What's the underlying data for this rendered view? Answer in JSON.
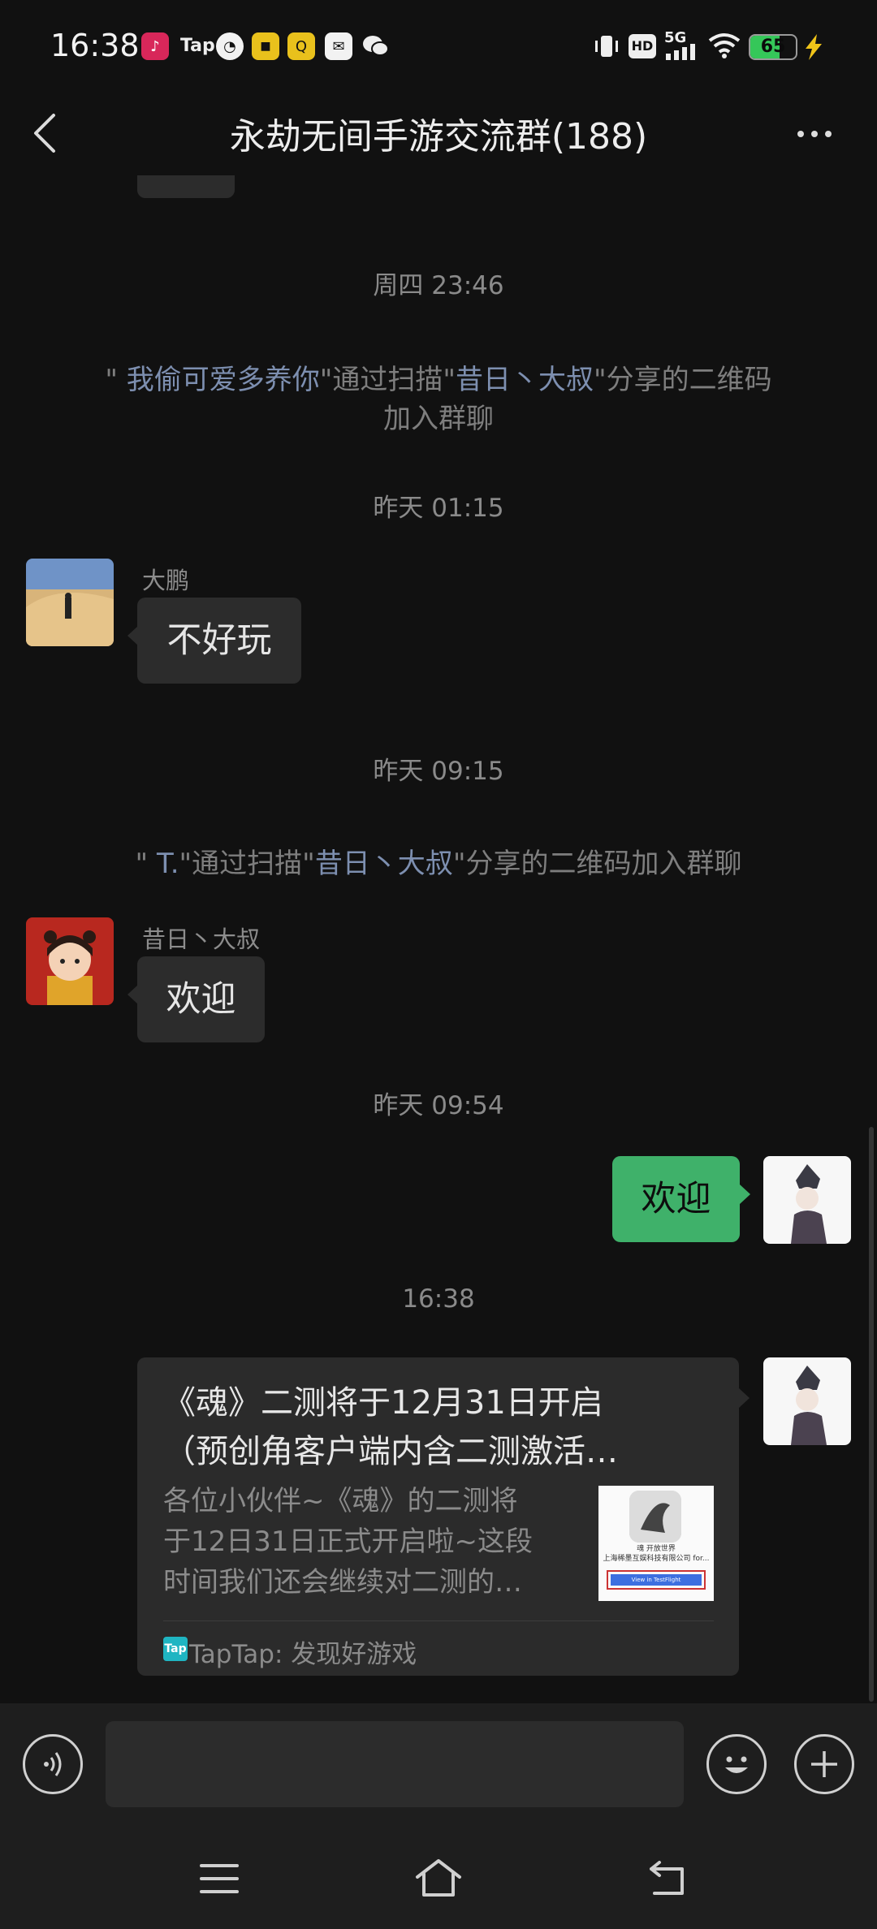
{
  "status_bar": {
    "time": "16:38",
    "apps": [
      "tiktok-icon",
      "taptap-icon",
      "speed-icon",
      "manga-icon",
      "q-icon",
      "mail-icon",
      "wechat-icon"
    ],
    "tap_label": "Tap",
    "network": "5G",
    "hd_label": "HD",
    "battery": "65",
    "battery_level": 0.65
  },
  "header": {
    "title": "永劫无间手游交流群(188)"
  },
  "chat": {
    "time1": "周四 23:46",
    "system1": {
      "q_open": "\" ",
      "user": "我偷可爱多养你",
      "text1": "\"通过扫描\"",
      "inviter": "昔日丶大叔",
      "text2": "\"分享的二维码",
      "line2": "加入群聊"
    },
    "time2": "昨天 01:15",
    "msg1": {
      "sender": "大鹏",
      "text": "不好玩"
    },
    "time3": "昨天 09:15",
    "system2": {
      "q_open": "\" ",
      "user": "T.",
      "text1": "\"通过扫描\"",
      "inviter": "昔日丶大叔",
      "text2": "\"分享的二维码加入群聊"
    },
    "msg2": {
      "sender": "昔日丶大叔",
      "text": "欢迎"
    },
    "time4": "昨天 09:54",
    "msg3": {
      "text": "欢迎"
    },
    "time5": "16:38",
    "card": {
      "title_line1": "《魂》二测将于12月31日开启",
      "title_line2": "（预创角客户端内含二测激活…",
      "desc_line1": "各位小伙伴~《魂》的二测将",
      "desc_line2": "于12日31日正式开启啦~这段",
      "desc_line3": "时间我们还会继续对二测的…",
      "thumb_line1": "魂 开放世界",
      "thumb_line2": "上海稀墨互娱科技有限公司 for...",
      "thumb_button": "View in TestFlight",
      "source_icon": "Tap",
      "source": "TapTap: 发现好游戏"
    }
  },
  "input": {
    "placeholder": ""
  },
  "colors": {
    "background": "#111111",
    "bubble_left": "#2c2c2c",
    "bubble_right": "#3fb16a",
    "link": "#7d8fb0"
  }
}
